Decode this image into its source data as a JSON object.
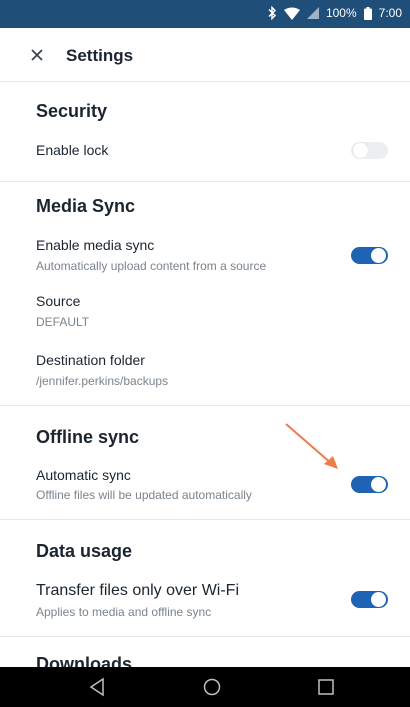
{
  "status_bar": {
    "battery": "100%",
    "time": "7:00",
    "icons": [
      "bluetooth-icon",
      "wifi-icon",
      "signal-icon",
      "battery-icon"
    ]
  },
  "app_bar": {
    "title": "Settings",
    "close_icon": "close-icon"
  },
  "sections": {
    "security": {
      "title": "Security",
      "enable_lock": {
        "title": "Enable lock",
        "on": false
      }
    },
    "media_sync": {
      "title": "Media Sync",
      "enable_media_sync": {
        "title": "Enable media sync",
        "subtitle": "Automatically upload content from a source",
        "on": true
      },
      "source": {
        "title": "Source",
        "value": "DEFAULT"
      },
      "destination": {
        "title": "Destination folder",
        "value": "/jennifer.perkins/backups"
      }
    },
    "offline_sync": {
      "title": "Offline sync",
      "automatic_sync": {
        "title": "Automatic sync",
        "subtitle": "Offline files will be updated automatically",
        "on": true
      }
    },
    "data_usage": {
      "title": "Data usage",
      "wifi_only": {
        "title": "Transfer files only over Wi-Fi",
        "subtitle": "Applies to media and offline sync",
        "on": true
      }
    },
    "downloads": {
      "title": "Downloads"
    }
  },
  "annotation": {
    "icon": "arrow-icon",
    "color": "#ee7b4c"
  },
  "nav_bar": {
    "icons": [
      "back-icon",
      "home-icon",
      "recents-icon"
    ]
  },
  "colors": {
    "status_bar": "#1f4e79",
    "toggle_on": "#1f63b4",
    "toggle_off": "#eceef0"
  }
}
